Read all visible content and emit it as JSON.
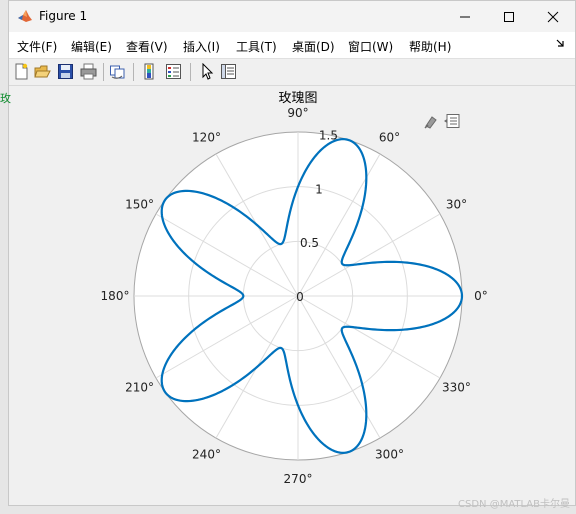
{
  "window": {
    "title": "Figure 1",
    "icons": {
      "app": "matlab-icon",
      "minimize": "minimize-icon",
      "maximize": "maximize-icon",
      "close": "close-icon"
    }
  },
  "menu": {
    "items": [
      "文件(F)",
      "编辑(E)",
      "查看(V)",
      "插入(I)",
      "工具(T)",
      "桌面(D)",
      "窗口(W)",
      "帮助(H)"
    ],
    "overflow_icon": "menu-arrow-icon"
  },
  "toolbar": {
    "icons": [
      "new-figure-icon",
      "open-file-icon",
      "save-icon",
      "print-icon",
      "link-plot-icon",
      "insert-colorbar-icon",
      "insert-legend-icon",
      "edit-plot-icon",
      "property-inspector-icon"
    ]
  },
  "axes_toolbar": {
    "icons": [
      "brush-icon",
      "data-tips-icon"
    ]
  },
  "side_text": "玫",
  "watermark": "CSDN @MATLAB卡尔曼",
  "colors": {
    "curve": "#0072BD",
    "grid": "#dcdcdc",
    "axes_bg": "#ffffff",
    "figure_bg": "#f0f0f0"
  },
  "chart_data": {
    "type": "line",
    "coordinate_system": "polar",
    "title": "玫瑰图",
    "function": "r = 1 + 0.5*cos(5*theta)",
    "theta_range_deg": [
      0,
      360
    ],
    "r_range": [
      0,
      1.5
    ],
    "r_ticks": [
      0,
      0.5,
      1,
      1.5
    ],
    "r_tick_labels": [
      "0",
      "0.5",
      "1",
      "1.5"
    ],
    "theta_ticks_deg": [
      0,
      30,
      60,
      90,
      120,
      150,
      180,
      210,
      240,
      270,
      300,
      330
    ],
    "theta_tick_labels": [
      "0°",
      "30°",
      "60°",
      "90°",
      "120°",
      "150°",
      "180°",
      "210°",
      "240°",
      "270°",
      "300°",
      "330°"
    ],
    "sample_points": [
      {
        "theta_deg": 0,
        "r": 1.5
      },
      {
        "theta_deg": 36,
        "r": 0.5
      },
      {
        "theta_deg": 72,
        "r": 1.5
      },
      {
        "theta_deg": 108,
        "r": 0.5
      },
      {
        "theta_deg": 144,
        "r": 1.5
      },
      {
        "theta_deg": 180,
        "r": 0.5
      },
      {
        "theta_deg": 216,
        "r": 1.5
      },
      {
        "theta_deg": 252,
        "r": 0.5
      },
      {
        "theta_deg": 288,
        "r": 1.5
      },
      {
        "theta_deg": 324,
        "r": 0.5
      }
    ],
    "grid": true,
    "legend": "none"
  }
}
